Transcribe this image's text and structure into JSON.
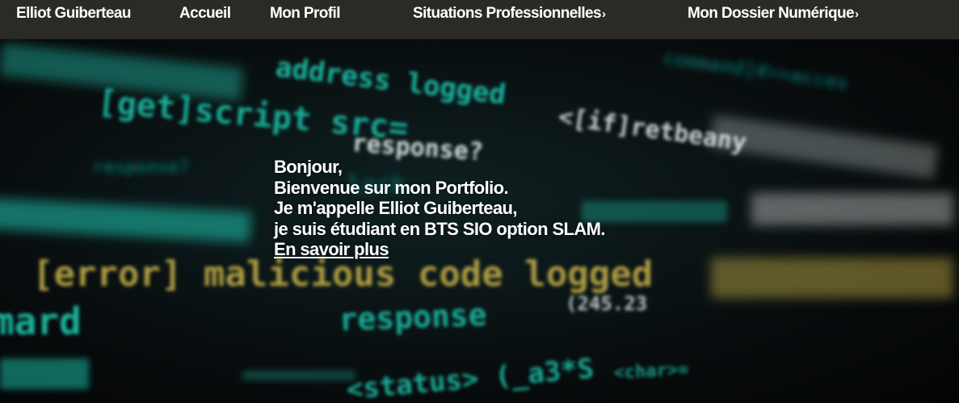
{
  "nav": {
    "brand": "Elliot Guiberteau",
    "home": "Accueil",
    "profile": "Mon Profil",
    "situations": "Situations Professionnelles",
    "dossier": "Mon Dossier Numérique",
    "arrow_glyph": "›"
  },
  "hero": {
    "line1": "Bonjour,",
    "line2": "Bienvenue sur mon Portfolio.",
    "line3": "Je m'appelle Elliot Guiberteau,",
    "line4": "je suis étudiant en BTS SIO option SLAM.",
    "link": "En savoir plus",
    "background": {
      "code_fragments": [
        "address logged",
        "[get]script src=",
        "<[if]retbeany",
        "response?",
        "response?",
        "[error] malicious code logged",
        "response",
        "(245.23",
        "mard",
        "<status> (_a3*S",
        "<char>=",
        "lock",
        "command]#>>acces"
      ],
      "colors": {
        "teal": "#1fc8b0",
        "teal_dark": "#0e6f66",
        "white": "#e8f2f0",
        "yellow": "#c9b44a"
      }
    }
  }
}
